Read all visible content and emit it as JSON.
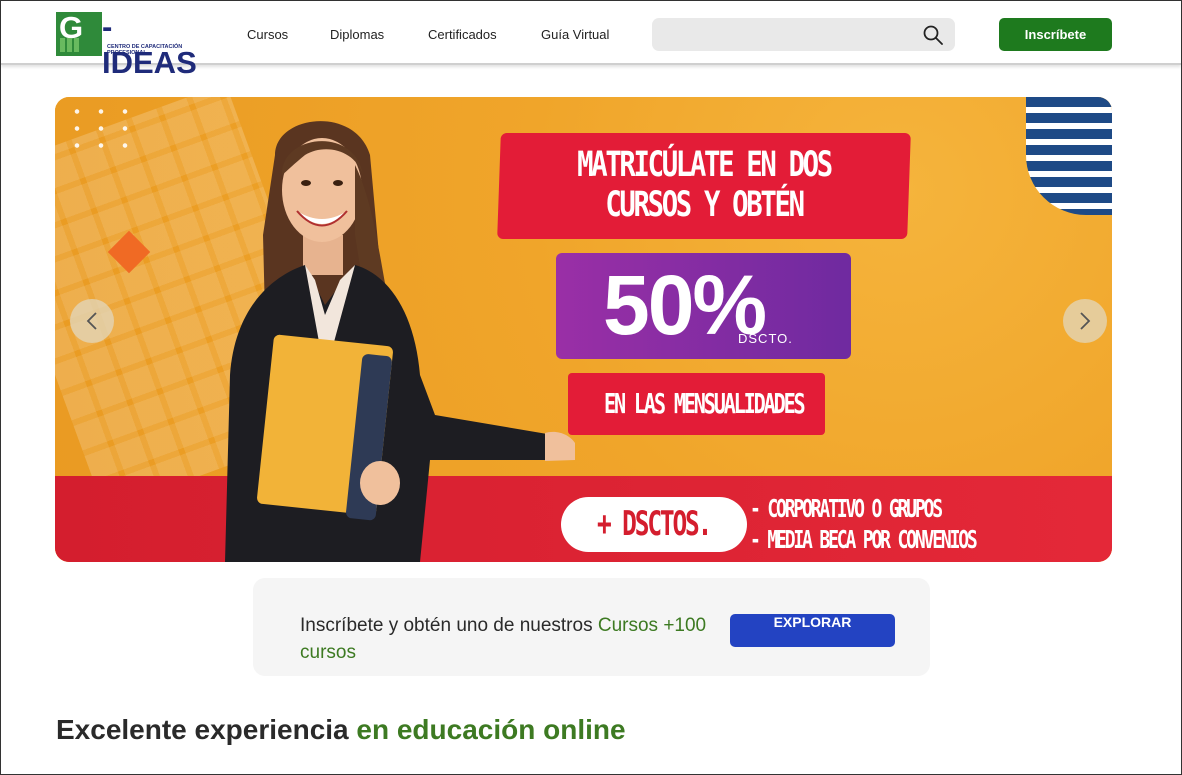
{
  "header": {
    "logo": {
      "word": "G-IDEAS",
      "mark": "G",
      "word_rest": "IDEAS",
      "tagline_1": "CENTRO DE CAPACITACIÓN",
      "tagline_2": "PROFESIONAL"
    },
    "nav": [
      {
        "label": "Cursos"
      },
      {
        "label": "Diplomas"
      },
      {
        "label": "Certificados"
      },
      {
        "label": "Guía Virtual"
      }
    ],
    "search": {
      "placeholder": "",
      "icon": "search-icon"
    },
    "cta_label": "Inscríbete",
    "accent_green": "#1e7a1e"
  },
  "banner": {
    "headline_1": "MATRICÚLATE EN DOS",
    "headline_2": "CURSOS Y OBTÉN",
    "discount": "50%",
    "discount_note": "DSCTO.",
    "subline": "EN LAS MENSUALIDADES",
    "extra_pill": "+ DSCTOS.",
    "extra_1": "- CORPORATIVO O GRUPOS",
    "extra_2": "- MEDIA BECA POR CONVENIOS",
    "prev_icon": "chevron-left-icon",
    "next_icon": "chevron-right-icon",
    "colors": {
      "background": "#f1a82a",
      "red": "#e31c37",
      "purple": "#8a2da4"
    }
  },
  "cta": {
    "text_1": "Inscríbete y obtén uno de nuestros ",
    "text_green": "Cursos +100 cursos",
    "button_label": "EXPLORAR",
    "button_color": "#2343c2"
  },
  "section": {
    "title_1": "Excelente experiencia ",
    "title_green": "en educación online",
    "green": "#3d7a22"
  }
}
